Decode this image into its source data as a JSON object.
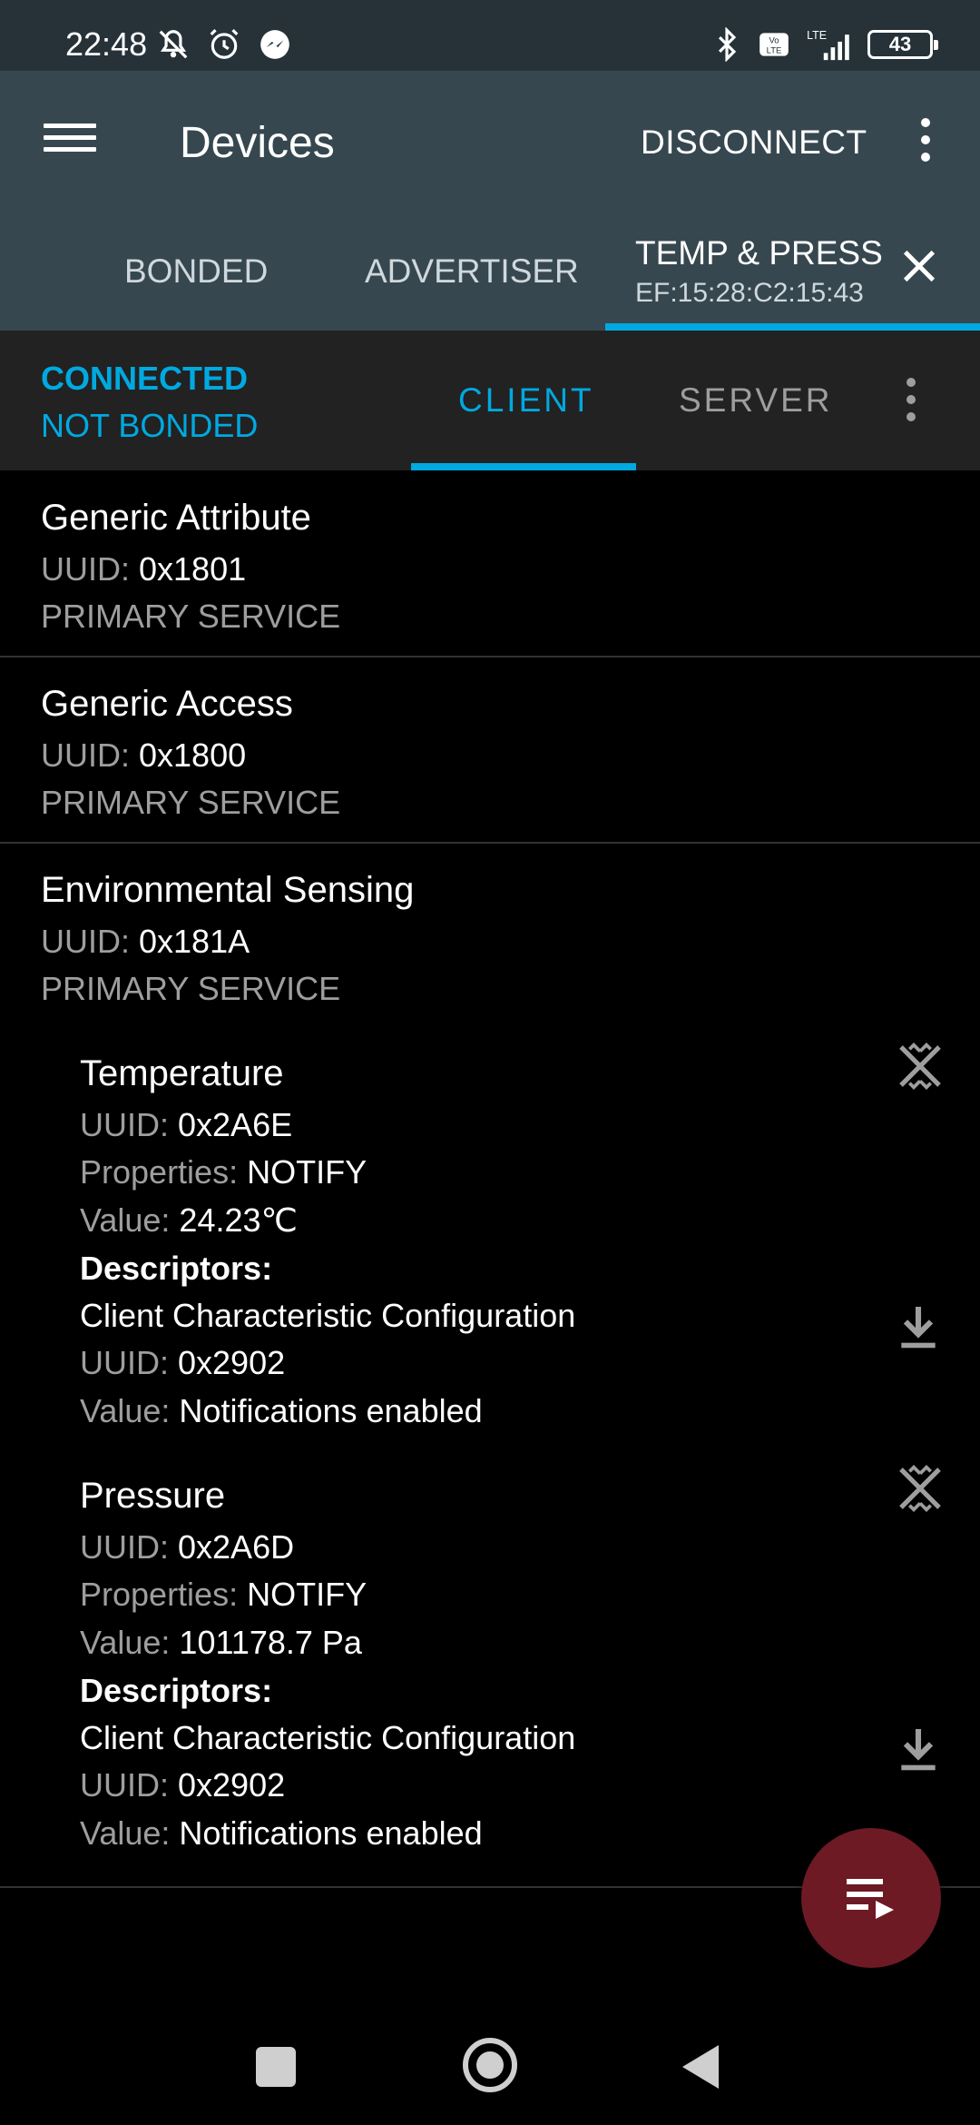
{
  "status_bar": {
    "time": "22:48",
    "battery": "43",
    "icons_left": [
      "mute-icon",
      "alarm-icon",
      "messenger-icon"
    ],
    "icons_right": [
      "bluetooth-icon",
      "volte-icon",
      "lte-signal-icon",
      "battery-icon"
    ]
  },
  "app_bar": {
    "title": "Devices",
    "disconnect_label": "DISCONNECT"
  },
  "device_tabs": {
    "bonded": "BONDED",
    "advertiser": "ADVERTISER",
    "active_name": "TEMP & PRESS",
    "active_address": "EF:15:28:C2:15:43"
  },
  "connection": {
    "state": "CONNECTED",
    "bond": "NOT BONDED",
    "tab_client": "CLIENT",
    "tab_server": "SERVER"
  },
  "labels": {
    "uuid": "UUID:",
    "properties": "Properties:",
    "value": "Value:",
    "descriptors": "Descriptors:"
  },
  "services": [
    {
      "name": "Generic Attribute",
      "uuid": "0x1801",
      "type": "PRIMARY SERVICE"
    },
    {
      "name": "Generic Access",
      "uuid": "0x1800",
      "type": "PRIMARY SERVICE"
    },
    {
      "name": "Environmental Sensing",
      "uuid": "0x181A",
      "type": "PRIMARY SERVICE"
    }
  ],
  "characteristics": [
    {
      "name": "Temperature",
      "uuid": "0x2A6E",
      "properties": "NOTIFY",
      "value": "24.23℃",
      "descriptor_name": "Client Characteristic Configuration",
      "descriptor_uuid": "0x2902",
      "descriptor_value": "Notifications enabled"
    },
    {
      "name": "Pressure",
      "uuid": "0x2A6D",
      "properties": "NOTIFY",
      "value": "101178.7 Pa",
      "descriptor_name": "Client Characteristic Configuration",
      "descriptor_uuid": "0x2902",
      "descriptor_value": "Notifications enabled"
    }
  ],
  "colors": {
    "accent": "#00a9e0",
    "app_bar": "#37474f",
    "fab": "#6d1a24"
  }
}
